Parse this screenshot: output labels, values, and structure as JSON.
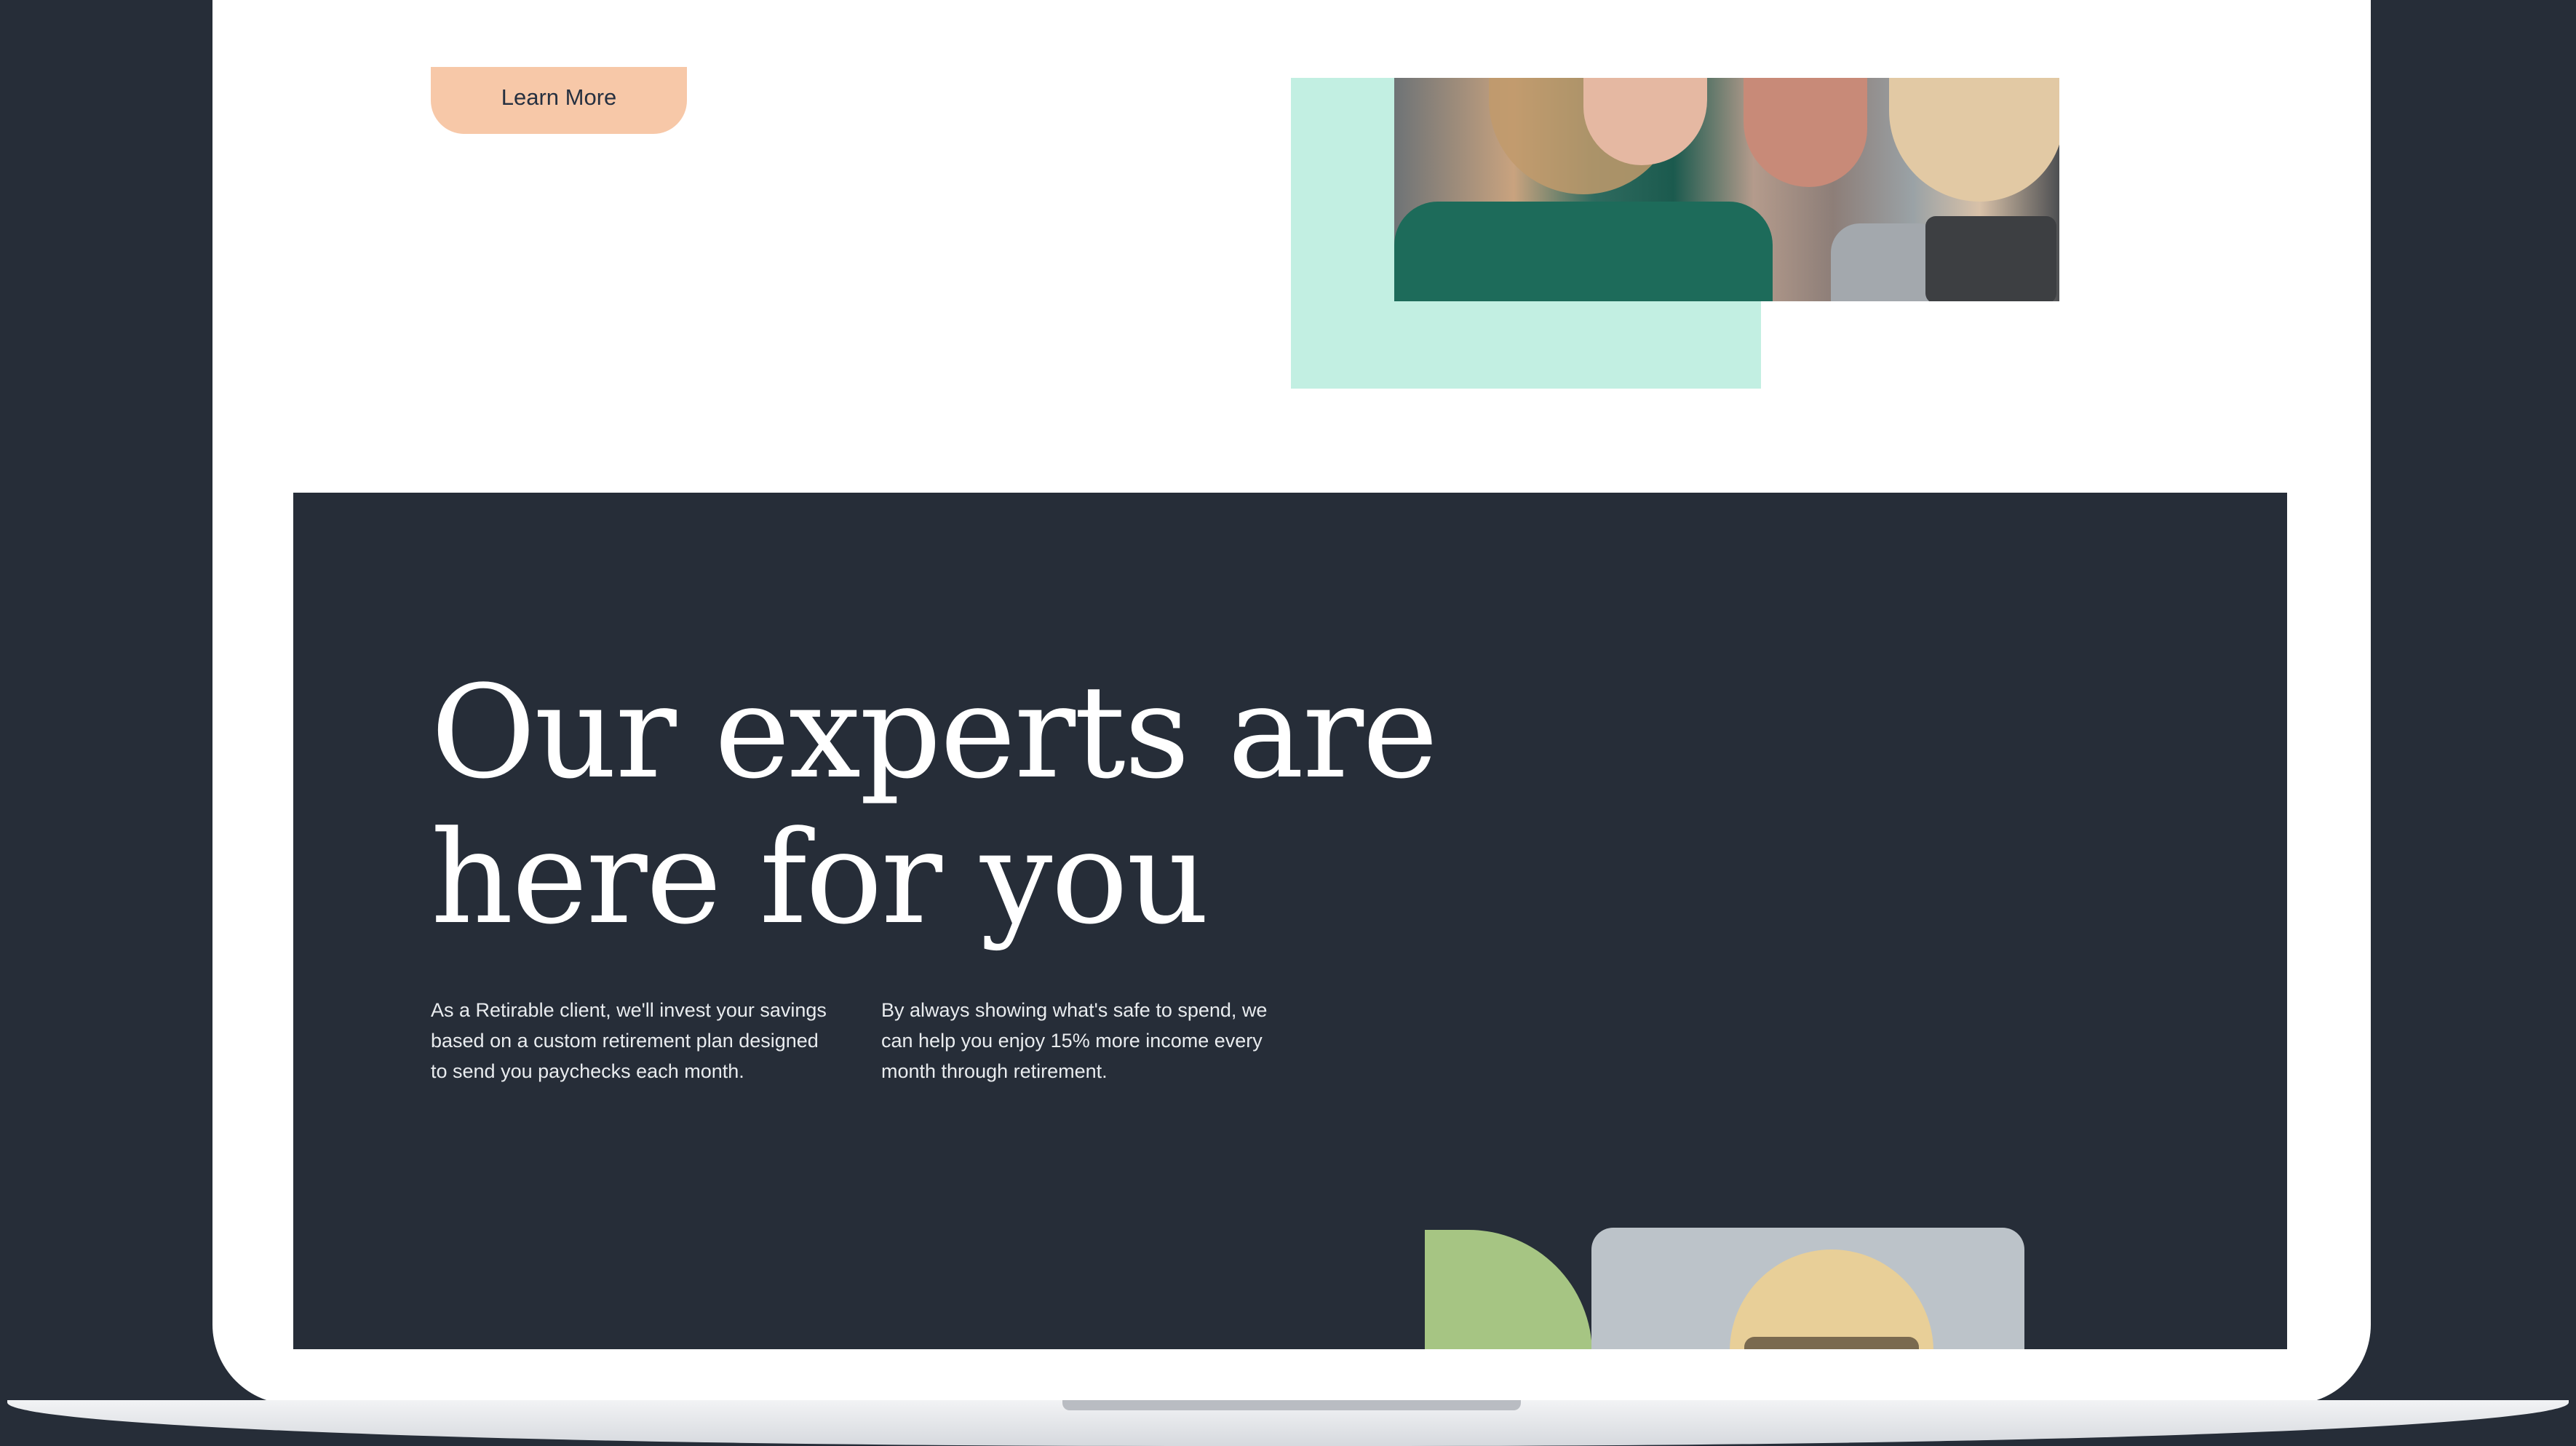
{
  "cta": {
    "learn_more": "Learn More"
  },
  "section": {
    "heading_line1": "Our experts are",
    "heading_line2": "here for you",
    "paragraph1": "As a Retirable client, we'll invest your savings based on a custom retirement plan designed to send you paychecks each month.",
    "paragraph2": "By always showing what's safe to spend, we can help you enjoy 15% more income every month through retirement."
  },
  "colors": {
    "background": "#262d38",
    "button": "#f7c8a8",
    "mint": "#c2efe2",
    "green_accent": "#a6c583"
  }
}
